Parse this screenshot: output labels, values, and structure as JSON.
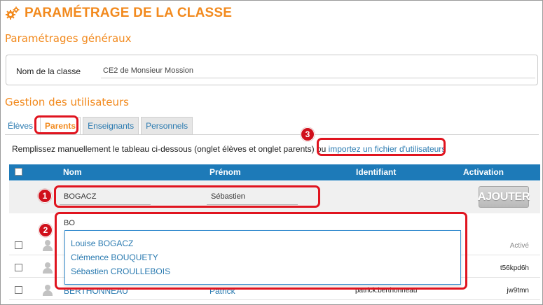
{
  "header": {
    "title": "PARAMÉTRAGE DE LA CLASSE",
    "icon": "gears-icon"
  },
  "general": {
    "heading": "Paramétrages généraux",
    "class_name_label": "Nom de la classe",
    "class_name_value": "CE2 de Monsieur Mossion"
  },
  "users": {
    "heading": "Gestion des utilisateurs",
    "tabs": [
      {
        "label": "Élèves"
      },
      {
        "label": "Parents",
        "active": true
      },
      {
        "label": "Enseignants"
      },
      {
        "label": "Personnels"
      }
    ],
    "instruction_text": "Remplissez manuellement le tableau ci-dessous (onglet élèves et onglet parents) ou",
    "import_link": "importez un fichier d'utilisateurs"
  },
  "table": {
    "columns": {
      "nom": "Nom",
      "prenom": "Prénom",
      "identifiant": "Identifiant",
      "activation": "Activation"
    },
    "entry": {
      "nom": "BOGACZ",
      "prenom": "Sébastien",
      "add_button": "AJOUTER"
    },
    "search_value": "BO",
    "rows": [
      {
        "nom": "",
        "prenom": "",
        "identifiant": "",
        "activation": "Activé"
      },
      {
        "nom": "",
        "prenom": "",
        "identifiant": "",
        "activation": "t56kpd6h"
      },
      {
        "nom": "BERTHONNEAU",
        "prenom": "Patrick",
        "identifiant": "patrick.berthonneau",
        "activation": "jw9tmn"
      }
    ]
  },
  "autocomplete": {
    "options": [
      "Louise BOGACZ",
      "Clémence BOUQUETY",
      "Sébastien CROULLEBOIS"
    ]
  },
  "callouts": {
    "badge1": "1",
    "badge2": "2",
    "badge3": "3"
  },
  "colors": {
    "accent": "#f28a1e",
    "header_blue": "#1d7ab8",
    "link": "#2a7ab0",
    "callout_red": "#e0141f"
  }
}
